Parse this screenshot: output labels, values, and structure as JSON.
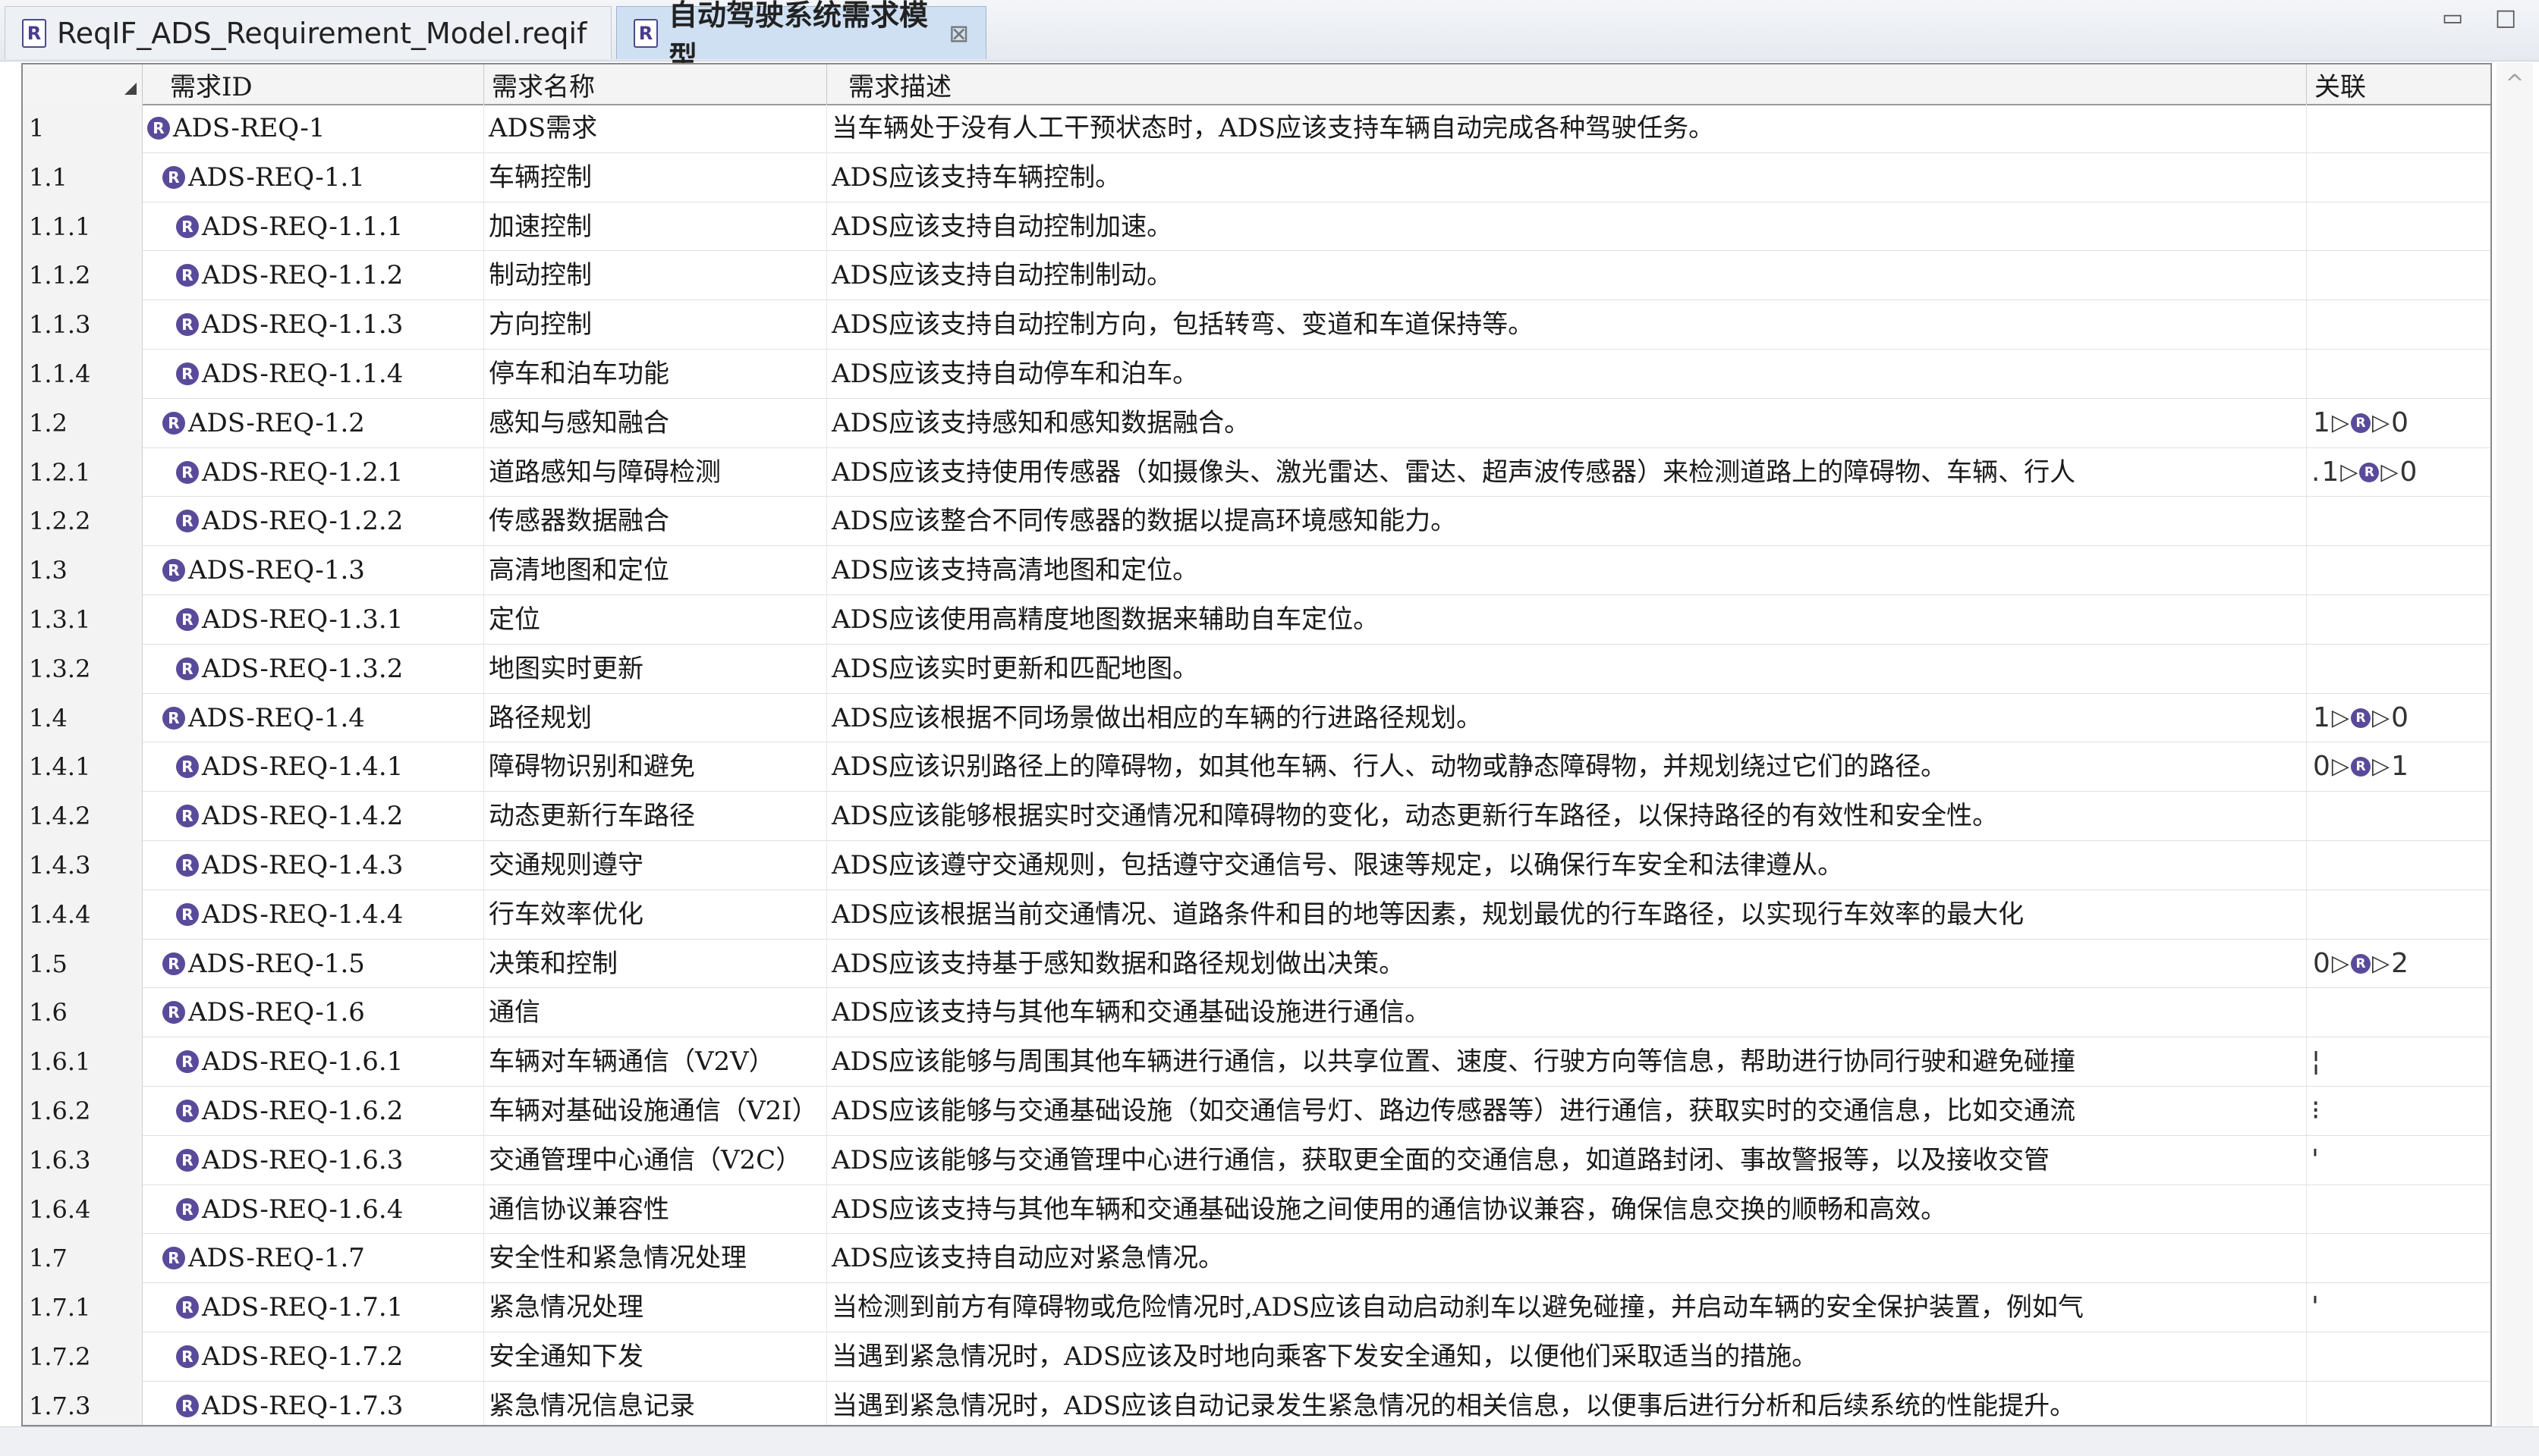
{
  "tabs": [
    {
      "label": "ReqIF_ADS_Requirement_Model.reqif",
      "icon": "R",
      "active": false
    },
    {
      "label": "自动驾驶系统需求模型",
      "icon": "R",
      "active": true,
      "close": "⊠"
    }
  ],
  "window": {
    "minimize": "▭",
    "maximize": "□"
  },
  "columns": {
    "id": "需求ID",
    "name": "需求名称",
    "desc": "需求描述",
    "link": "关联"
  },
  "rows": [
    {
      "num": "1",
      "id": "ADS-REQ-1",
      "name": "ADS需求",
      "desc": "当车辆处于没有人工干预状态时，ADS应该支持车辆自动完成各种驾驶任务。",
      "link": null,
      "level": 1
    },
    {
      "num": "1.1",
      "id": "ADS-REQ-1.1",
      "name": "车辆控制",
      "desc": "ADS应该支持车辆控制。",
      "link": null,
      "level": 2
    },
    {
      "num": "1.1.1",
      "id": "ADS-REQ-1.1.1",
      "name": "加速控制",
      "desc": "ADS应该支持自动控制加速。",
      "link": null,
      "level": 3
    },
    {
      "num": "1.1.2",
      "id": "ADS-REQ-1.1.2",
      "name": "制动控制",
      "desc": "ADS应该支持自动控制制动。",
      "link": null,
      "level": 3
    },
    {
      "num": "1.1.3",
      "id": "ADS-REQ-1.1.3",
      "name": "方向控制",
      "desc": "ADS应该支持自动控制方向，包括转弯、变道和车道保持等。",
      "link": null,
      "level": 3
    },
    {
      "num": "1.1.4",
      "id": "ADS-REQ-1.1.4",
      "name": "停车和泊车功能",
      "desc": "ADS应该支持自动停车和泊车。",
      "link": null,
      "level": 3
    },
    {
      "num": "1.2",
      "id": "ADS-REQ-1.2",
      "name": "感知与感知融合",
      "desc": "ADS应该支持感知和感知数据融合。",
      "link": {
        "pre": "",
        "in": "1",
        "out": "0"
      },
      "level": 2
    },
    {
      "num": "1.2.1",
      "id": "ADS-REQ-1.2.1",
      "name": "道路感知与障碍检测",
      "desc": "ADS应该支持使用传感器（如摄像头、激光雷达、雷达、超声波传感器）来检测道路上的障碍物、车辆、行人",
      "link": {
        "pre": ".",
        "in": "1",
        "out": "0"
      },
      "level": 3
    },
    {
      "num": "1.2.2",
      "id": "ADS-REQ-1.2.2",
      "name": "传感器数据融合",
      "desc": "ADS应该整合不同传感器的数据以提高环境感知能力。",
      "link": null,
      "level": 3
    },
    {
      "num": "1.3",
      "id": "ADS-REQ-1.3",
      "name": "高清地图和定位",
      "desc": "ADS应该支持高清地图和定位。",
      "link": null,
      "level": 2
    },
    {
      "num": "1.3.1",
      "id": "ADS-REQ-1.3.1",
      "name": "定位",
      "desc": "ADS应该使用高精度地图数据来辅助自车定位。",
      "link": null,
      "level": 3
    },
    {
      "num": "1.3.2",
      "id": "ADS-REQ-1.3.2",
      "name": "地图实时更新",
      "desc": "ADS应该实时更新和匹配地图。",
      "link": null,
      "level": 3
    },
    {
      "num": "1.4",
      "id": "ADS-REQ-1.4",
      "name": "路径规划",
      "desc": "ADS应该根据不同场景做出相应的车辆的行进路径规划。",
      "link": {
        "pre": "",
        "in": "1",
        "out": "0"
      },
      "level": 2
    },
    {
      "num": "1.4.1",
      "id": "ADS-REQ-1.4.1",
      "name": "障碍物识别和避免",
      "desc": "ADS应该识别路径上的障碍物，如其他车辆、行人、动物或静态障碍物，并规划绕过它们的路径。",
      "link": {
        "pre": "",
        "in": "0",
        "out": "1"
      },
      "level": 3
    },
    {
      "num": "1.4.2",
      "id": "ADS-REQ-1.4.2",
      "name": "动态更新行车路径",
      "desc": "ADS应该能够根据实时交通情况和障碍物的变化，动态更新行车路径，以保持路径的有效性和安全性。",
      "link": null,
      "level": 3
    },
    {
      "num": "1.4.3",
      "id": "ADS-REQ-1.4.3",
      "name": "交通规则遵守",
      "desc": "ADS应该遵守交通规则，包括遵守交通信号、限速等规定，以确保行车安全和法律遵从。",
      "link": null,
      "level": 3
    },
    {
      "num": "1.4.4",
      "id": "ADS-REQ-1.4.4",
      "name": "行车效率优化",
      "desc": "ADS应该根据当前交通情况、道路条件和目的地等因素，规划最优的行车路径，以实现行车效率的最大化",
      "link": null,
      "level": 3
    },
    {
      "num": "1.5",
      "id": "ADS-REQ-1.5",
      "name": "决策和控制",
      "desc": "ADS应该支持基于感知数据和路径规划做出决策。",
      "link": {
        "pre": "",
        "in": "0",
        "out": "2"
      },
      "level": 2
    },
    {
      "num": "1.6",
      "id": "ADS-REQ-1.6",
      "name": "通信",
      "desc": "ADS应该支持与其他车辆和交通基础设施进行通信。",
      "link": null,
      "level": 2
    },
    {
      "num": "1.6.1",
      "id": "ADS-REQ-1.6.1",
      "name": "车辆对车辆通信（V2V）",
      "desc": "ADS应该能够与周围其他车辆进行通信，以共享位置、速度、行驶方向等信息，帮助进行协同行驶和避免碰撞",
      "link": {
        "pre": "¦",
        "in": "",
        "out": ""
      },
      "level": 3
    },
    {
      "num": "1.6.2",
      "id": "ADS-REQ-1.6.2",
      "name": "车辆对基础设施通信（V2I）",
      "desc": "ADS应该能够与交通基础设施（如交通信号灯、路边传感器等）进行通信，获取实时的交通信息，比如交通流",
      "link": {
        "pre": "⁝",
        "in": "",
        "out": ""
      },
      "level": 3
    },
    {
      "num": "1.6.3",
      "id": "ADS-REQ-1.6.3",
      "name": "交通管理中心通信（V2C）",
      "desc": "ADS应该能够与交通管理中心进行通信，获取更全面的交通信息，如道路封闭、事故警报等，以及接收交管",
      "link": {
        "pre": "'",
        "in": "",
        "out": ""
      },
      "level": 3
    },
    {
      "num": "1.6.4",
      "id": "ADS-REQ-1.6.4",
      "name": "通信协议兼容性",
      "desc": "ADS应该支持与其他车辆和交通基础设施之间使用的通信协议兼容，确保信息交换的顺畅和高效。",
      "link": null,
      "level": 3
    },
    {
      "num": "1.7",
      "id": "ADS-REQ-1.7",
      "name": "安全性和紧急情况处理",
      "desc": "ADS应该支持自动应对紧急情况。",
      "link": null,
      "level": 2
    },
    {
      "num": "1.7.1",
      "id": "ADS-REQ-1.7.1",
      "name": "紧急情况处理",
      "desc": "当检测到前方有障碍物或危险情况时,ADS应该自动启动刹车以避免碰撞，并启动车辆的安全保护装置，例如气",
      "link": {
        "pre": "'",
        "in": "",
        "out": ""
      },
      "level": 3
    },
    {
      "num": "1.7.2",
      "id": "ADS-REQ-1.7.2",
      "name": "安全通知下发",
      "desc": "当遇到紧急情况时，ADS应该及时地向乘客下发安全通知，以便他们采取适当的措施。",
      "link": null,
      "level": 3
    },
    {
      "num": "1.7.3",
      "id": "ADS-REQ-1.7.3",
      "name": "紧急情况信息记录",
      "desc": "当遇到紧急情况时，ADS应该自动记录发生紧急情况的相关信息，以便事后进行分析和后续系统的性能提升。",
      "link": null,
      "level": 3
    }
  ]
}
